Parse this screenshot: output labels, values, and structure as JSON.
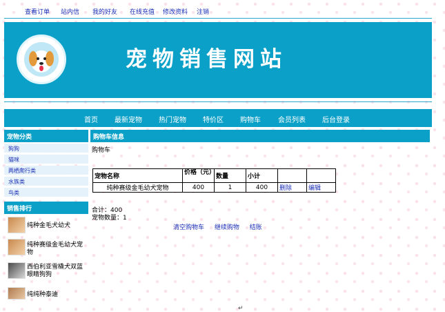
{
  "top_nav": [
    "查看订单",
    "站内信",
    "我的好友",
    "在线充值",
    "修改资料",
    "注销"
  ],
  "site_title": "宠物销售网站",
  "main_nav": [
    "首页",
    "最新宠物",
    "热门宠物",
    "特价区",
    "购物车",
    "会员列表",
    "后台登录"
  ],
  "sidebar": {
    "category_title": "宠物分类",
    "categories": [
      "狗狗",
      "猫咪",
      "两栖爬行类",
      "水族类",
      "鸟类"
    ],
    "ranking_title": "销售排行",
    "ranking": [
      "纯种金毛犬幼犬",
      "纯种赛级金毛幼犬宠物",
      "西伯利亚雪橇犬双蓝眼睛狗狗",
      "纯纯种泰迪"
    ]
  },
  "cart": {
    "header": "购物车信息",
    "breadcrumb": "购物车",
    "columns": [
      "宠物名称",
      "价格（元）",
      "数量",
      "小计",
      "",
      ""
    ],
    "rows": [
      {
        "name": "纯种赛级金毛幼犬宠物",
        "price": "400",
        "qty": "1",
        "subtotal": "400",
        "delete": "删除",
        "edit": "编辑"
      }
    ],
    "total": "合计：400",
    "count": "宠物数量：1",
    "actions": [
      "清空购物车",
      "继续购物",
      "结账"
    ]
  },
  "paragraph_mark": "↵",
  "colors": {
    "accent": "#0aa0c8",
    "link": "#1b2fb5"
  }
}
